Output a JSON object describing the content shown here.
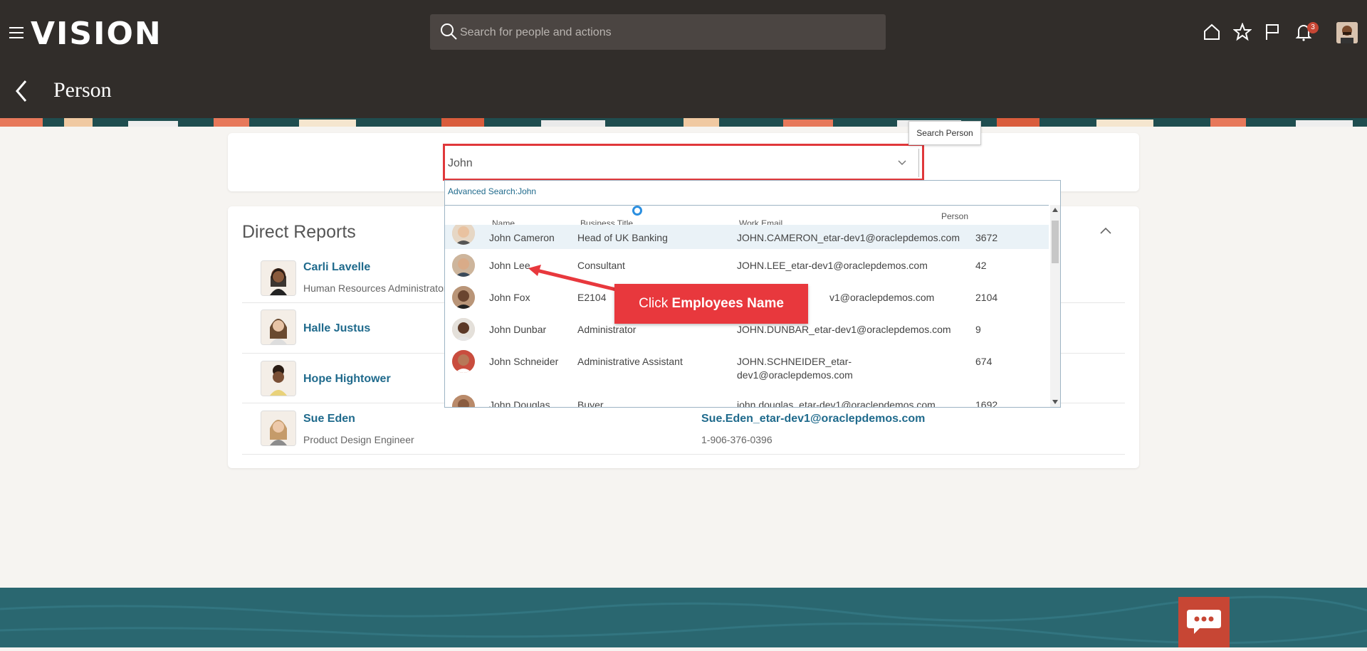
{
  "app": {
    "logo": "VISION"
  },
  "header": {
    "search_placeholder": "Search for people and actions",
    "notification_count": "3"
  },
  "page": {
    "title": "Person"
  },
  "person_search": {
    "value": "John",
    "tooltip": "Search Person",
    "advanced_search": "Advanced Search:John",
    "columns": [
      "Name",
      "Business Title",
      "Work Email",
      "Person Number"
    ],
    "rows": [
      {
        "name": "John Cameron",
        "title": "Head of UK Banking",
        "email": "JOHN.CAMERON_etar-dev1@oraclepdemos.com",
        "number": "3672"
      },
      {
        "name": "John Lee",
        "title": "Consultant",
        "email": "JOHN.LEE_etar-dev1@oraclepdemos.com",
        "number": "42"
      },
      {
        "name": "John Fox",
        "title": "E2104",
        "email": "v1@oraclepdemos.com",
        "number": "2104"
      },
      {
        "name": "John Dunbar",
        "title": "Administrator",
        "email": "JOHN.DUNBAR_etar-dev1@oraclepdemos.com",
        "number": "9"
      },
      {
        "name": "John Schneider",
        "title": "Administrative Assistant",
        "email": "JOHN.SCHNEIDER_etar-",
        "email2": "dev1@oraclepdemos.com",
        "number": "674"
      },
      {
        "name": "John Douglas",
        "title": "Buyer",
        "email": "john.douglas_etar-dev1@oraclepdemos.com",
        "number": "1692"
      }
    ]
  },
  "callout": {
    "prefix": "Click ",
    "bold": "Employees Name"
  },
  "direct_reports": {
    "title": "Direct Reports",
    "people": [
      {
        "name": "Carli Lavelle",
        "title": "Human Resources Administrator"
      },
      {
        "name": "Halle Justus",
        "title": ""
      },
      {
        "name": "Hope Hightower",
        "title": ""
      },
      {
        "name": "Sue Eden",
        "title": "Product Design Engineer",
        "email": "Sue.Eden_etar-dev1@oraclepdemos.com",
        "phone": "1-906-376-0396"
      }
    ]
  },
  "colors": {
    "header": "#312d2a",
    "accent_red": "#e0383b",
    "link": "#1f6a8c",
    "footer": "#2a6770"
  },
  "icons": [
    "menu-icon",
    "search-icon",
    "home-icon",
    "star-icon",
    "flag-icon",
    "bell-icon",
    "back-icon",
    "chevron-down-icon",
    "chevron-up-icon",
    "chat-icon"
  ]
}
